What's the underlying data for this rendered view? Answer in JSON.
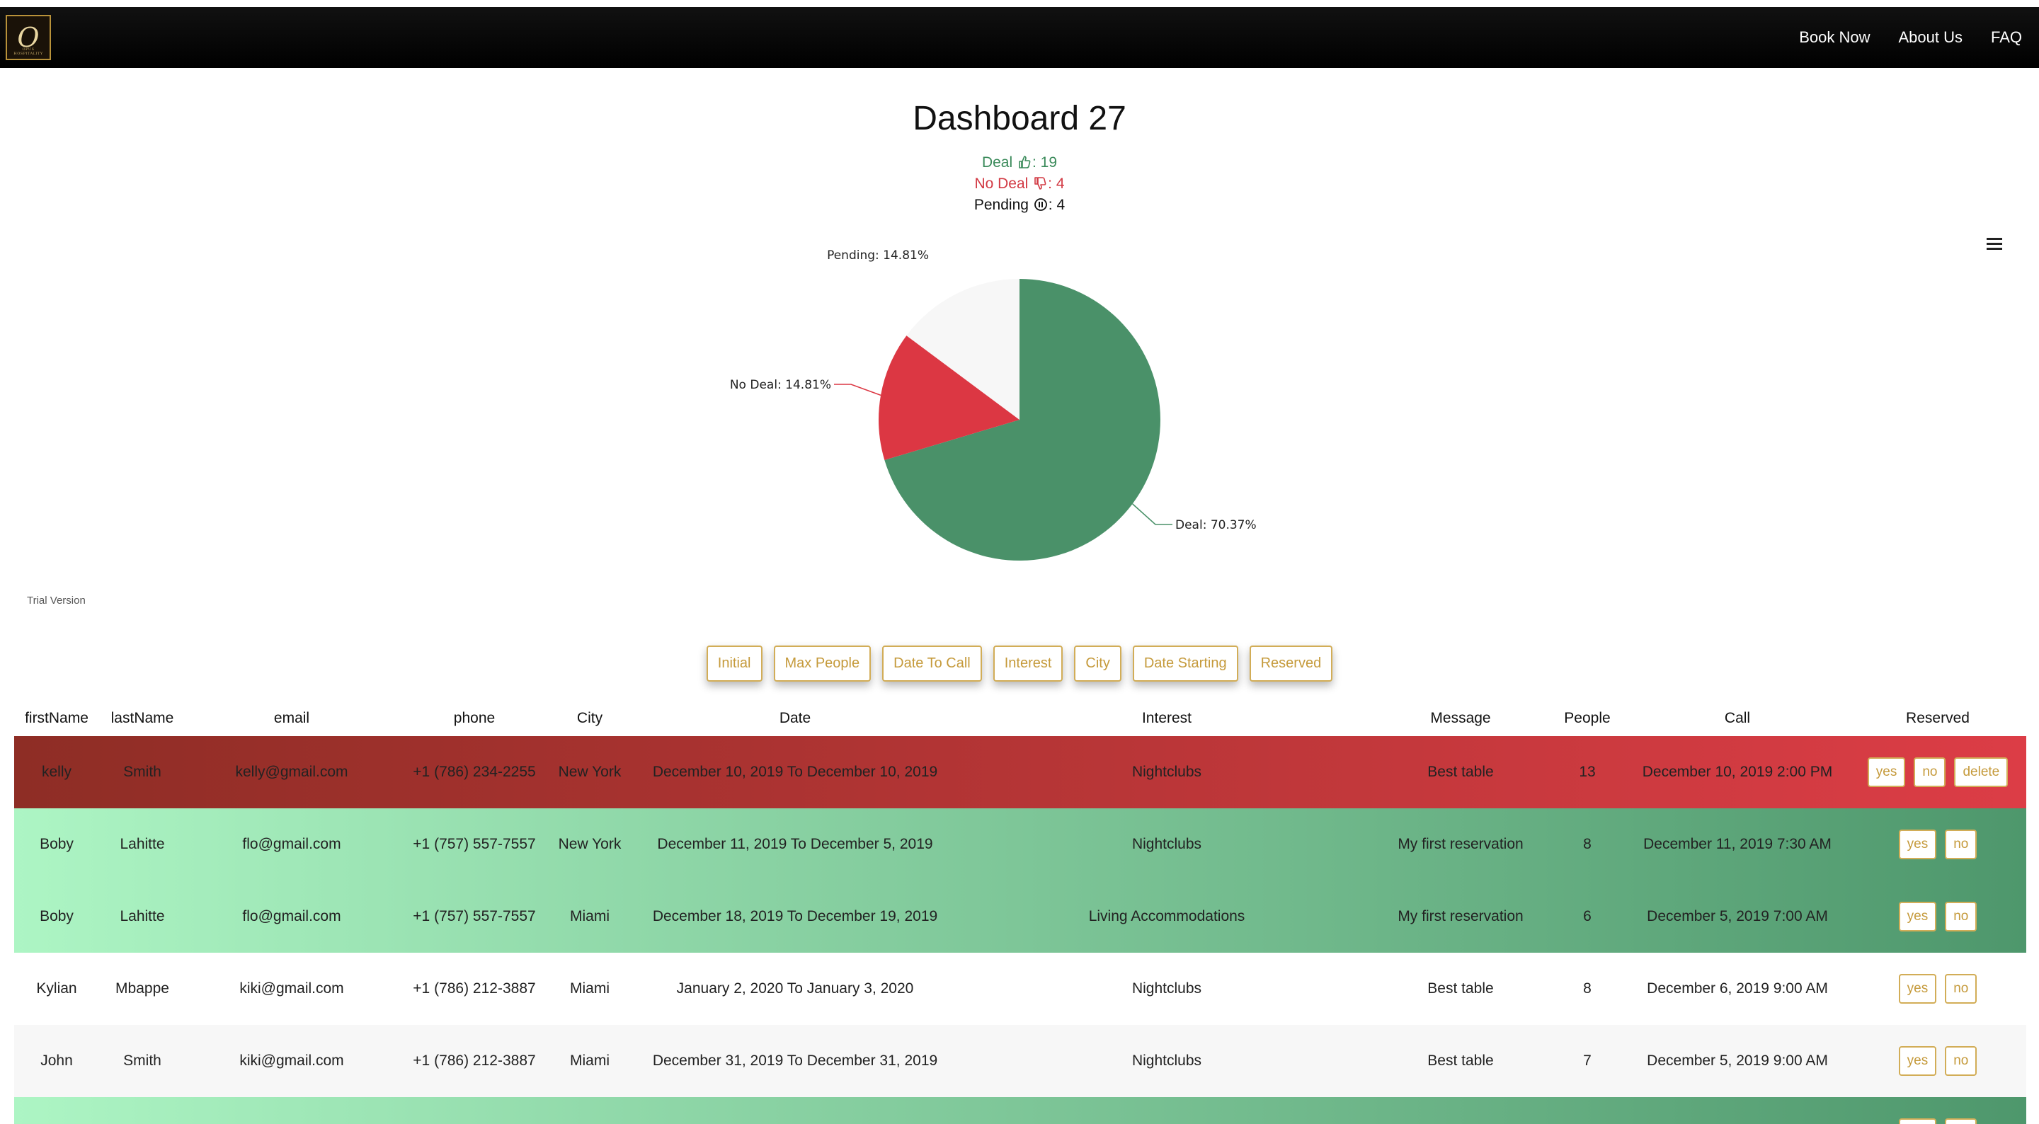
{
  "nav": {
    "logo_text": "O",
    "logo_sub": "OPUS HOSPITALITY",
    "links": [
      "Book Now",
      "About Us",
      "FAQ"
    ]
  },
  "dashboard": {
    "title": "Dashboard 27",
    "deal_label": "Deal",
    "deal_count": ": 19",
    "nodeal_label": "No Deal",
    "nodeal_count": ": 4",
    "pending_label": "Pending",
    "pending_count": ": 4"
  },
  "trial_text": "Trial Version",
  "colors": {
    "deal": "#4a9169",
    "nodeal": "#dc3743",
    "pending": "#f7f7f7",
    "accent": "#c59a3b"
  },
  "chart_data": {
    "type": "pie",
    "slices": [
      {
        "name": "Deal",
        "value": 70.37,
        "label": "Deal: 70.37%",
        "color": "#4a9169"
      },
      {
        "name": "No Deal",
        "value": 14.81,
        "label": "No Deal: 14.81%",
        "color": "#dc3743"
      },
      {
        "name": "Pending",
        "value": 14.81,
        "label": "Pending: 14.81%",
        "color": "#f7f7f7"
      }
    ]
  },
  "filters": [
    "Initial",
    "Max People",
    "Date To Call",
    "Interest",
    "City",
    "Date Starting",
    "Reserved"
  ],
  "table": {
    "columns": [
      "firstName",
      "lastName",
      "email",
      "phone",
      "City",
      "Date",
      "Interest",
      "Message",
      "People",
      "Call",
      "Reserved"
    ],
    "rows": [
      {
        "style": "red",
        "cells": [
          "kelly",
          "Smith",
          "kelly@gmail.com",
          "+1 (786) 234-2255",
          "New York",
          "December 10, 2019 To December 10, 2019",
          "Nightclubs",
          "Best table",
          "13",
          "December 10, 2019 2:00 PM"
        ],
        "actions": [
          "yes",
          "no",
          "delete"
        ]
      },
      {
        "style": "green",
        "cells": [
          "Boby",
          "Lahitte",
          "flo@gmail.com",
          "+1 (757) 557-7557",
          "New York",
          "December 11, 2019 To December 5, 2019",
          "Nightclubs",
          "My first reservation",
          "8",
          "December 11, 2019 7:30 AM"
        ],
        "actions": [
          "yes",
          "no"
        ]
      },
      {
        "style": "green",
        "cells": [
          "Boby",
          "Lahitte",
          "flo@gmail.com",
          "+1 (757) 557-7557",
          "Miami",
          "December 18, 2019 To December 19, 2019",
          "Living Accommodations",
          "My first reservation",
          "6",
          "December 5, 2019 7:00 AM"
        ],
        "actions": [
          "yes",
          "no"
        ]
      },
      {
        "style": "white",
        "cells": [
          "Kylian",
          "Mbappe",
          "kiki@gmail.com",
          "+1 (786) 212-3887",
          "Miami",
          "January 2, 2020 To January 3, 2020",
          "Nightclubs",
          "Best table",
          "8",
          "December 6, 2019 9:00 AM"
        ],
        "actions": [
          "yes",
          "no"
        ]
      },
      {
        "style": "grey",
        "cells": [
          "John",
          "Smith",
          "kiki@gmail.com",
          "+1 (786) 212-3887",
          "Miami",
          "December 31, 2019 To December 31, 2019",
          "Nightclubs",
          "Best table",
          "7",
          "December 5, 2019 9:00 AM"
        ],
        "actions": [
          "yes",
          "no"
        ]
      },
      {
        "style": "green",
        "cells": [
          "",
          "",
          "",
          "",
          "",
          "",
          "",
          "",
          "",
          ""
        ],
        "actions": [
          "yes",
          "no"
        ]
      }
    ]
  }
}
